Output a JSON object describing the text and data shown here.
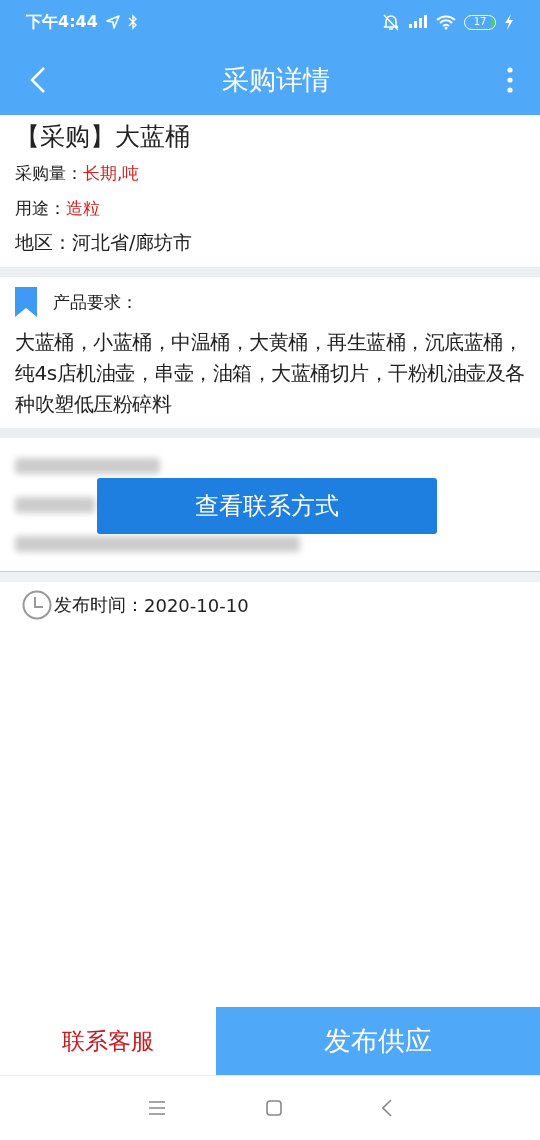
{
  "status_bar": {
    "time": "下午4:44",
    "battery": "17"
  },
  "header": {
    "title": "采购详情"
  },
  "purchase": {
    "title": "【采购】大蓝桶",
    "fields": [
      {
        "label": "采购量：",
        "value": "长期,吨",
        "highlight": true
      },
      {
        "label": "用途：",
        "value": "造粒",
        "highlight": true
      },
      {
        "label": "地区：",
        "value": "河北省/廊坊市",
        "highlight": false
      }
    ]
  },
  "requirements": {
    "heading": "产品要求：",
    "text": "大蓝桶，小蓝桶，中温桶，大黄桶，再生蓝桶，沉底蓝桶，纯4s店机油壶，串壶，油箱，大蓝桶切片，干粉机油壶及各种吹塑低压粉碎料"
  },
  "contact": {
    "button": "查看联系方式"
  },
  "publish": {
    "label": "发布时间：",
    "date": "2020-10-10"
  },
  "bottom_bar": {
    "service": "联系客服",
    "supply": "发布供应"
  }
}
